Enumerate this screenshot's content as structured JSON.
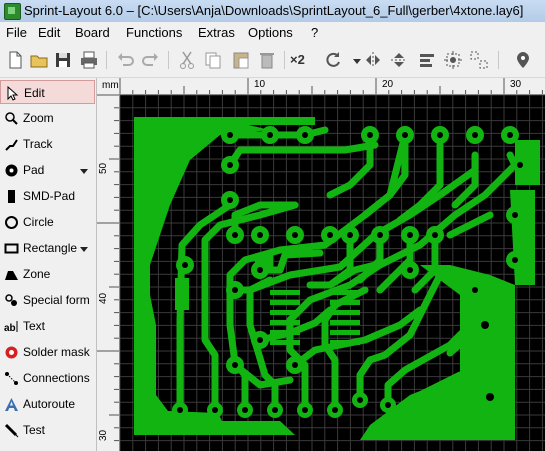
{
  "window": {
    "title": "Sprint-Layout 6.0 – [C:\\Users\\Anja\\Downloads\\SprintLayout_6_Full\\gerber\\4xtone.lay6]"
  },
  "menu": [
    "File",
    "Edit",
    "Board",
    "Functions",
    "Extras",
    "Options",
    "?"
  ],
  "toolbar": {
    "multiply_label": "×2",
    "icons": [
      "new-file-icon",
      "open-folder-icon",
      "save-icon",
      "print-icon",
      "undo-icon",
      "redo-icon",
      "cut-icon",
      "copy-icon",
      "paste-icon",
      "delete-icon",
      "rotate-icon",
      "mirror-horizontal-icon",
      "mirror-vertical-icon",
      "align-icon",
      "group-icon",
      "ungroup-icon",
      "properties-icon"
    ]
  },
  "tools": [
    {
      "label": "Edit",
      "icon": "cursor-arrow-icon",
      "active": true
    },
    {
      "label": "Zoom",
      "icon": "magnifier-icon"
    },
    {
      "label": "Track",
      "icon": "track-icon"
    },
    {
      "label": "Pad",
      "icon": "pad-icon",
      "dropdown": true
    },
    {
      "label": "SMD-Pad",
      "icon": "smd-pad-icon"
    },
    {
      "label": "Circle",
      "icon": "circle-icon"
    },
    {
      "label": "Rectangle",
      "icon": "rectangle-icon",
      "dropdown": true
    },
    {
      "label": "Zone",
      "icon": "zone-icon"
    },
    {
      "label": "Special form",
      "icon": "special-form-icon"
    },
    {
      "label": "Text",
      "icon": "text-icon"
    },
    {
      "label": "Solder mask",
      "icon": "solder-mask-icon"
    },
    {
      "label": "Connections",
      "icon": "connections-icon"
    },
    {
      "label": "Autoroute",
      "icon": "autoroute-icon"
    },
    {
      "label": "Test",
      "icon": "test-icon"
    }
  ],
  "ruler": {
    "unit": "mm",
    "top_labels": [
      "10",
      "20",
      "30"
    ],
    "left_labels": [
      "50",
      "40",
      "30"
    ]
  },
  "colors": {
    "copper": "#12b412",
    "background": "#000000",
    "grid": "#3a3a3a",
    "active_tool_bg": "#f5dada"
  }
}
